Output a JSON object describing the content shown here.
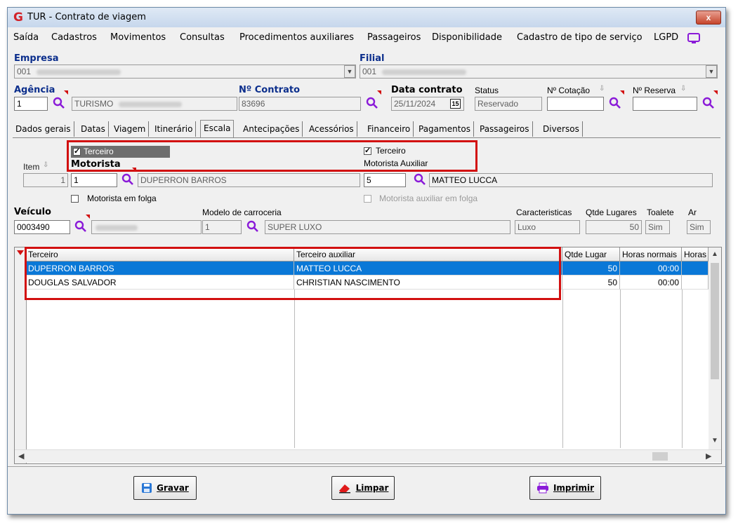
{
  "window": {
    "title": "TUR - Contrato de viagem",
    "logo": "G",
    "close": "x"
  },
  "menu": [
    "Saída",
    "Cadastros",
    "Movimentos",
    "Consultas",
    "Procedimentos auxiliares",
    "Passageiros",
    "Disponibilidade",
    "Cadastro de tipo de serviço",
    "LGPD"
  ],
  "header": {
    "empresa_label": "Empresa",
    "empresa_code": "001",
    "filial_label": "Filial",
    "filial_code": "001",
    "agencia_label": "Agência",
    "agencia_code": "1",
    "agencia_name": "TURISMO",
    "contrato_label": "Nº Contrato",
    "contrato_value": "83696",
    "data_label": "Data contrato",
    "data_value": "25/11/2024",
    "calendar_icon": "15",
    "status_label": "Status",
    "status_value": "Reservado",
    "cotacao_label": "Nº Cotação",
    "cotacao_value": "",
    "reserva_label": "Nº Reserva",
    "reserva_value": ""
  },
  "tabs": [
    "Dados gerais",
    "Datas",
    "Viagem",
    "Itinerário",
    "Escala",
    "Antecipações",
    "Acessórios",
    "Financeiro",
    "Pagamentos",
    "Passageiros",
    "Diversos"
  ],
  "active_tab": "Escala",
  "escala": {
    "item_label": "Item",
    "item_value": "1",
    "terceiro_label": "Terceiro",
    "terceiro_checked": true,
    "motorista_label": "Motorista",
    "motorista_code": "1",
    "motorista_name": "DUPERRON BARROS",
    "folga_label": "Motorista em folga",
    "terceiro_aux_label": "Terceiro",
    "terceiro_aux_checked": true,
    "motorista_aux_label": "Motorista Auxiliar",
    "motorista_aux_code": "5",
    "motorista_aux_name": "MATTEO LUCCA",
    "folga_aux_label": "Motorista auxiliar em folga",
    "veiculo_label": "Veículo",
    "veiculo_code": "0003490",
    "modelo_label": "Modelo de carroceria",
    "modelo_code": "1",
    "modelo_name": "SUPER LUXO",
    "caract_label": "Caracteristicas",
    "caract_value": "Luxo",
    "qtde_label": "Qtde Lugares",
    "qtde_value": "50",
    "toalete_label": "Toalete",
    "toalete_value": "Sim",
    "ar_label": "Ar",
    "ar_value": "Sim"
  },
  "grid": {
    "columns": [
      "Terceiro",
      "Terceiro auxiliar",
      "Qtde Lugar",
      "Horas normais",
      "Horas"
    ],
    "rows": [
      {
        "terceiro": "DUPERRON BARROS",
        "auxiliar": "MATTEO LUCCA",
        "qtde": "50",
        "horas": "00:00"
      },
      {
        "terceiro": "DOUGLAS SALVADOR",
        "auxiliar": "CHRISTIAN NASCIMENTO",
        "qtde": "50",
        "horas": "00:00"
      }
    ]
  },
  "buttons": {
    "gravar": "Gravar",
    "limpar": "Limpar",
    "imprimir": "Imprimir"
  },
  "colors": {
    "label_blue": "#0b2e8c",
    "highlight": "#d21010",
    "selection": "#0a78d7"
  }
}
